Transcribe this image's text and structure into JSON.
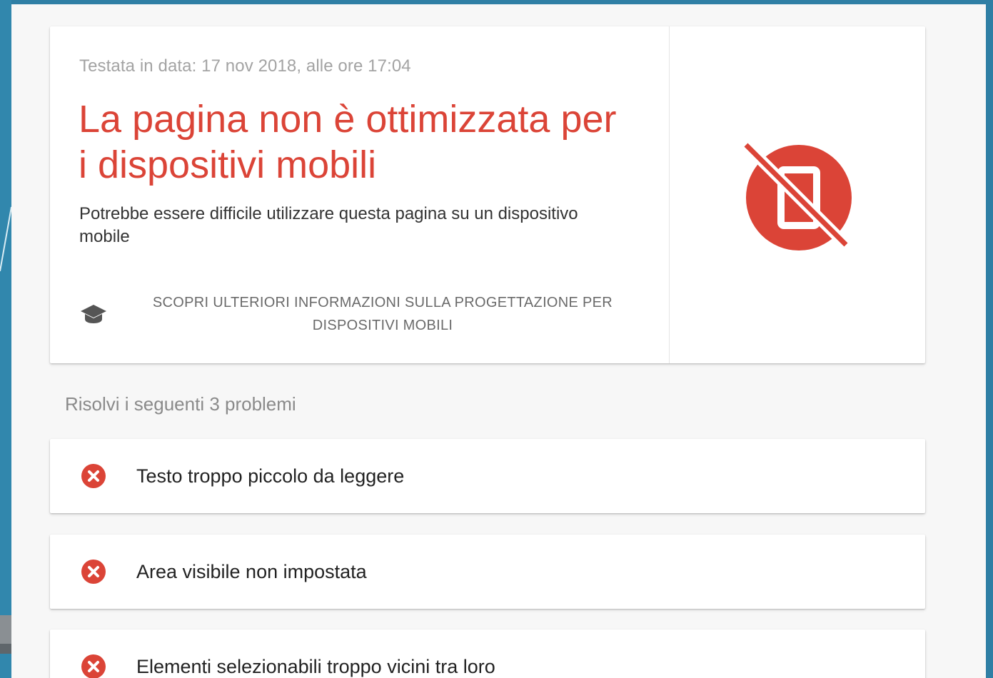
{
  "hero": {
    "tested_date": "Testata in data: 17 nov 2018, alle ore 17:04",
    "title": "La pagina non è ottimizzata per i dispositivi mobili",
    "description": "Potrebbe essere difficile utilizzare questa pagina su un dispositivo mobile",
    "learn_more_label": "SCOPRI ULTERIORI INFORMAZIONI SULLA PROGETTAZIONE PER DISPOSITIVI MOBILI",
    "learn_more_icon": "school-icon",
    "status_icon": "not-mobile-friendly-icon"
  },
  "issues": {
    "heading": "Risolvi i seguenti 3 problemi",
    "items": [
      {
        "label": "Testo troppo piccolo da leggere",
        "icon": "error-icon"
      },
      {
        "label": "Area visibile non impostata",
        "icon": "error-icon"
      },
      {
        "label": "Elementi selezionabili troppo vicini tra loro",
        "icon": "error-icon"
      }
    ]
  },
  "colors": {
    "error_red": "#db4437",
    "panel_background": "#f7f7f7",
    "page_background": "#2f80a6"
  }
}
